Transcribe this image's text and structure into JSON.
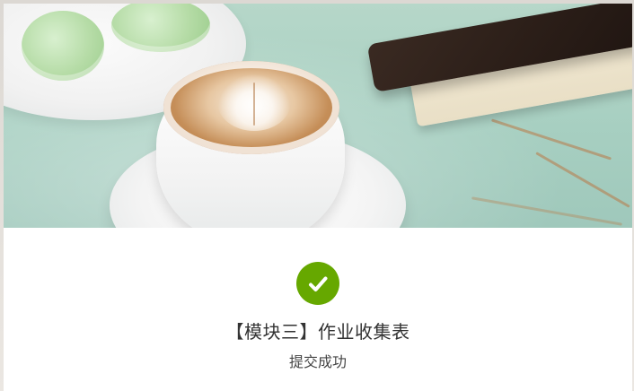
{
  "banner": {
    "image_alt": "coffee-latte-photo"
  },
  "status": {
    "icon": "checkmark-circle-icon",
    "icon_color": "#66a800"
  },
  "form": {
    "title": "【模块三】作业收集表",
    "message": "提交成功"
  }
}
